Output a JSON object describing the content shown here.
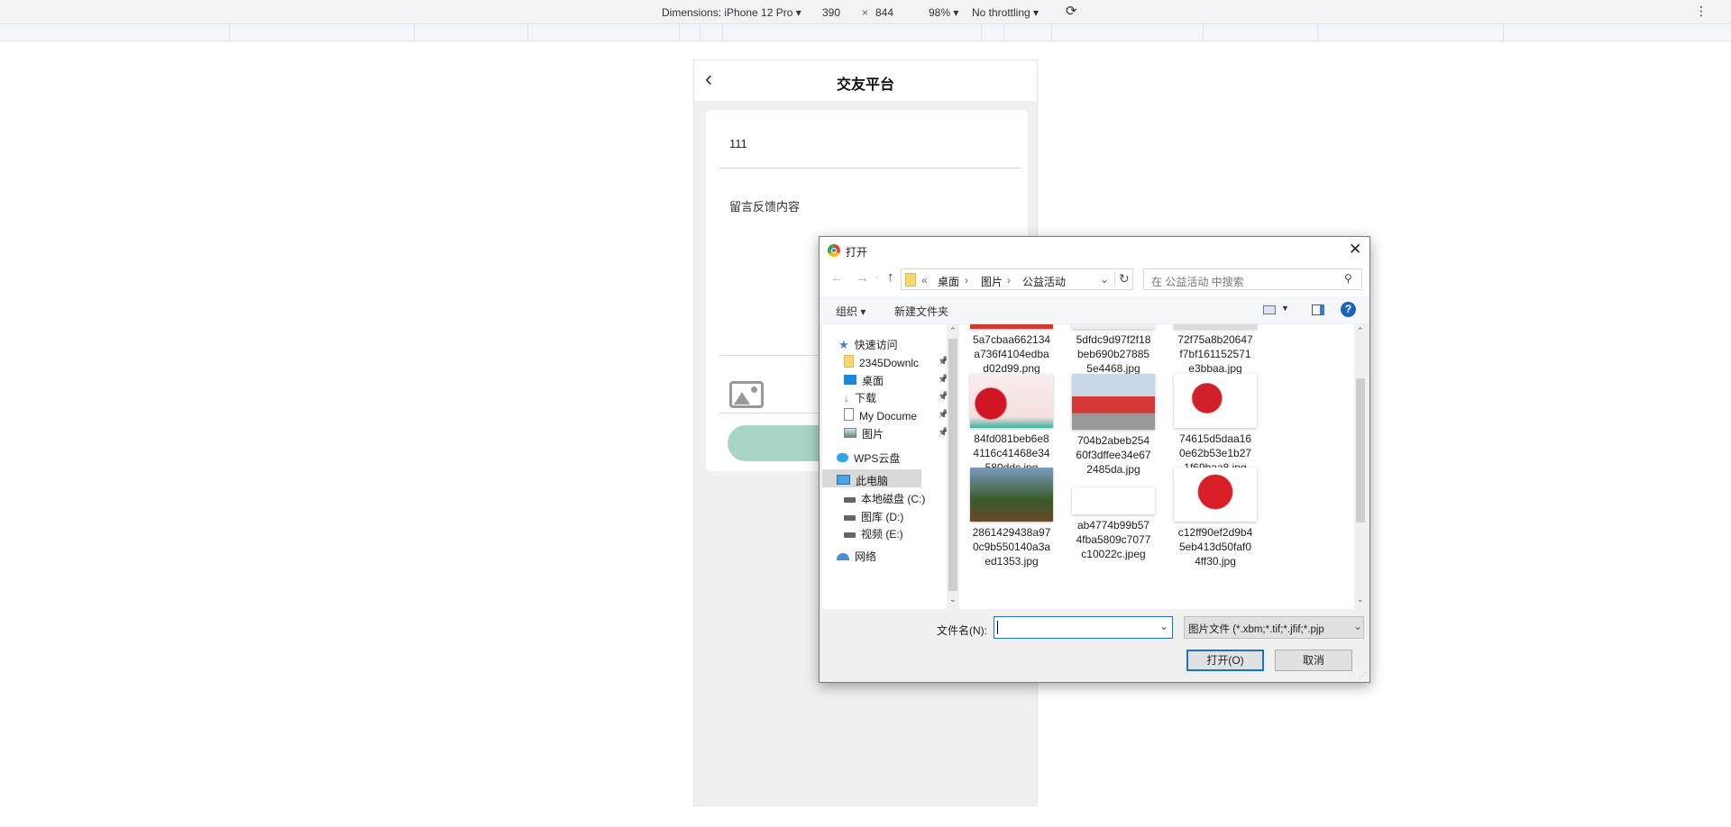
{
  "devtools": {
    "dimensions_label": "Dimensions: iPhone 12 Pro",
    "width": "390",
    "times": "×",
    "height": "844",
    "zoom": "98%",
    "throttling": "No throttling",
    "rotate_icon": "rotate-icon",
    "more_icon": "more-vert-icon"
  },
  "page": {
    "title": "交友平台",
    "back_icon": "chevron-left-icon",
    "title_value": "111",
    "content_placeholder": "留言反馈内容",
    "upload_icon": "image-upload-icon",
    "submit_color": "#a8d5c5"
  },
  "dialog": {
    "title": "打开",
    "breadcrumb": [
      "«",
      "桌面",
      "›",
      "图片",
      "›",
      "公益活动"
    ],
    "search_placeholder": "在 公益活动 中搜索",
    "organize": "组织 ▾",
    "new_folder": "新建文件夹",
    "nav": [
      {
        "label": "快速访问",
        "icon": "star-icon"
      },
      {
        "label": "2345Downlc",
        "icon": "folder-icon",
        "pinned": true
      },
      {
        "label": "桌面",
        "icon": "desktop-icon",
        "pinned": true
      },
      {
        "label": "下载",
        "icon": "download-icon",
        "pinned": true
      },
      {
        "label": "My Docume",
        "icon": "document-icon",
        "pinned": true
      },
      {
        "label": "图片",
        "icon": "pictures-icon",
        "pinned": true
      },
      {
        "label": "WPS云盘",
        "icon": "cloud-icon"
      },
      {
        "label": "此电脑",
        "icon": "computer-icon",
        "selected": true
      },
      {
        "label": "本地磁盘 (C:)",
        "icon": "drive-icon"
      },
      {
        "label": "图库 (D:)",
        "icon": "drive-icon"
      },
      {
        "label": "视频 (E:)",
        "icon": "drive-icon"
      },
      {
        "label": "网络",
        "icon": "network-icon"
      }
    ],
    "files": [
      {
        "name": [
          "5a7cbaa662134",
          "a736f4104edba",
          "d02d99.png"
        ]
      },
      {
        "name": [
          "5dfdc9d97f2f18",
          "beb690b27885",
          "5e4468.jpg"
        ]
      },
      {
        "name": [
          "72f75a8b20647",
          "f7bf161152571",
          "e3bbaa.jpg"
        ]
      },
      {
        "name": [
          "84fd081beb6e8",
          "4116c41468e34",
          "580ddc.jpg"
        ]
      },
      {
        "name": [
          "704b2abeb254",
          "60f3dffee34e67",
          "2485da.jpg"
        ]
      },
      {
        "name": [
          "74615d5daa16",
          "0e62b53e1b27",
          "1f69baa8.jpg"
        ]
      },
      {
        "name": [
          "2861429438a97",
          "0c9b550140a3a",
          "ed1353.jpg"
        ]
      },
      {
        "name": [
          "ab4774b99b57",
          "4fba5809c7077",
          "c10022c.jpeg"
        ]
      },
      {
        "name": [
          "c12ff90ef2d9b4",
          "5eb413d50faf0",
          "4ff30.jpg"
        ]
      }
    ],
    "filename_label": "文件名(N):",
    "filename_value": "",
    "filetype": "图片文件 (*.xbm;*.tif;*.jfif;*.pjp",
    "open": "打开(O)",
    "cancel": "取消"
  }
}
